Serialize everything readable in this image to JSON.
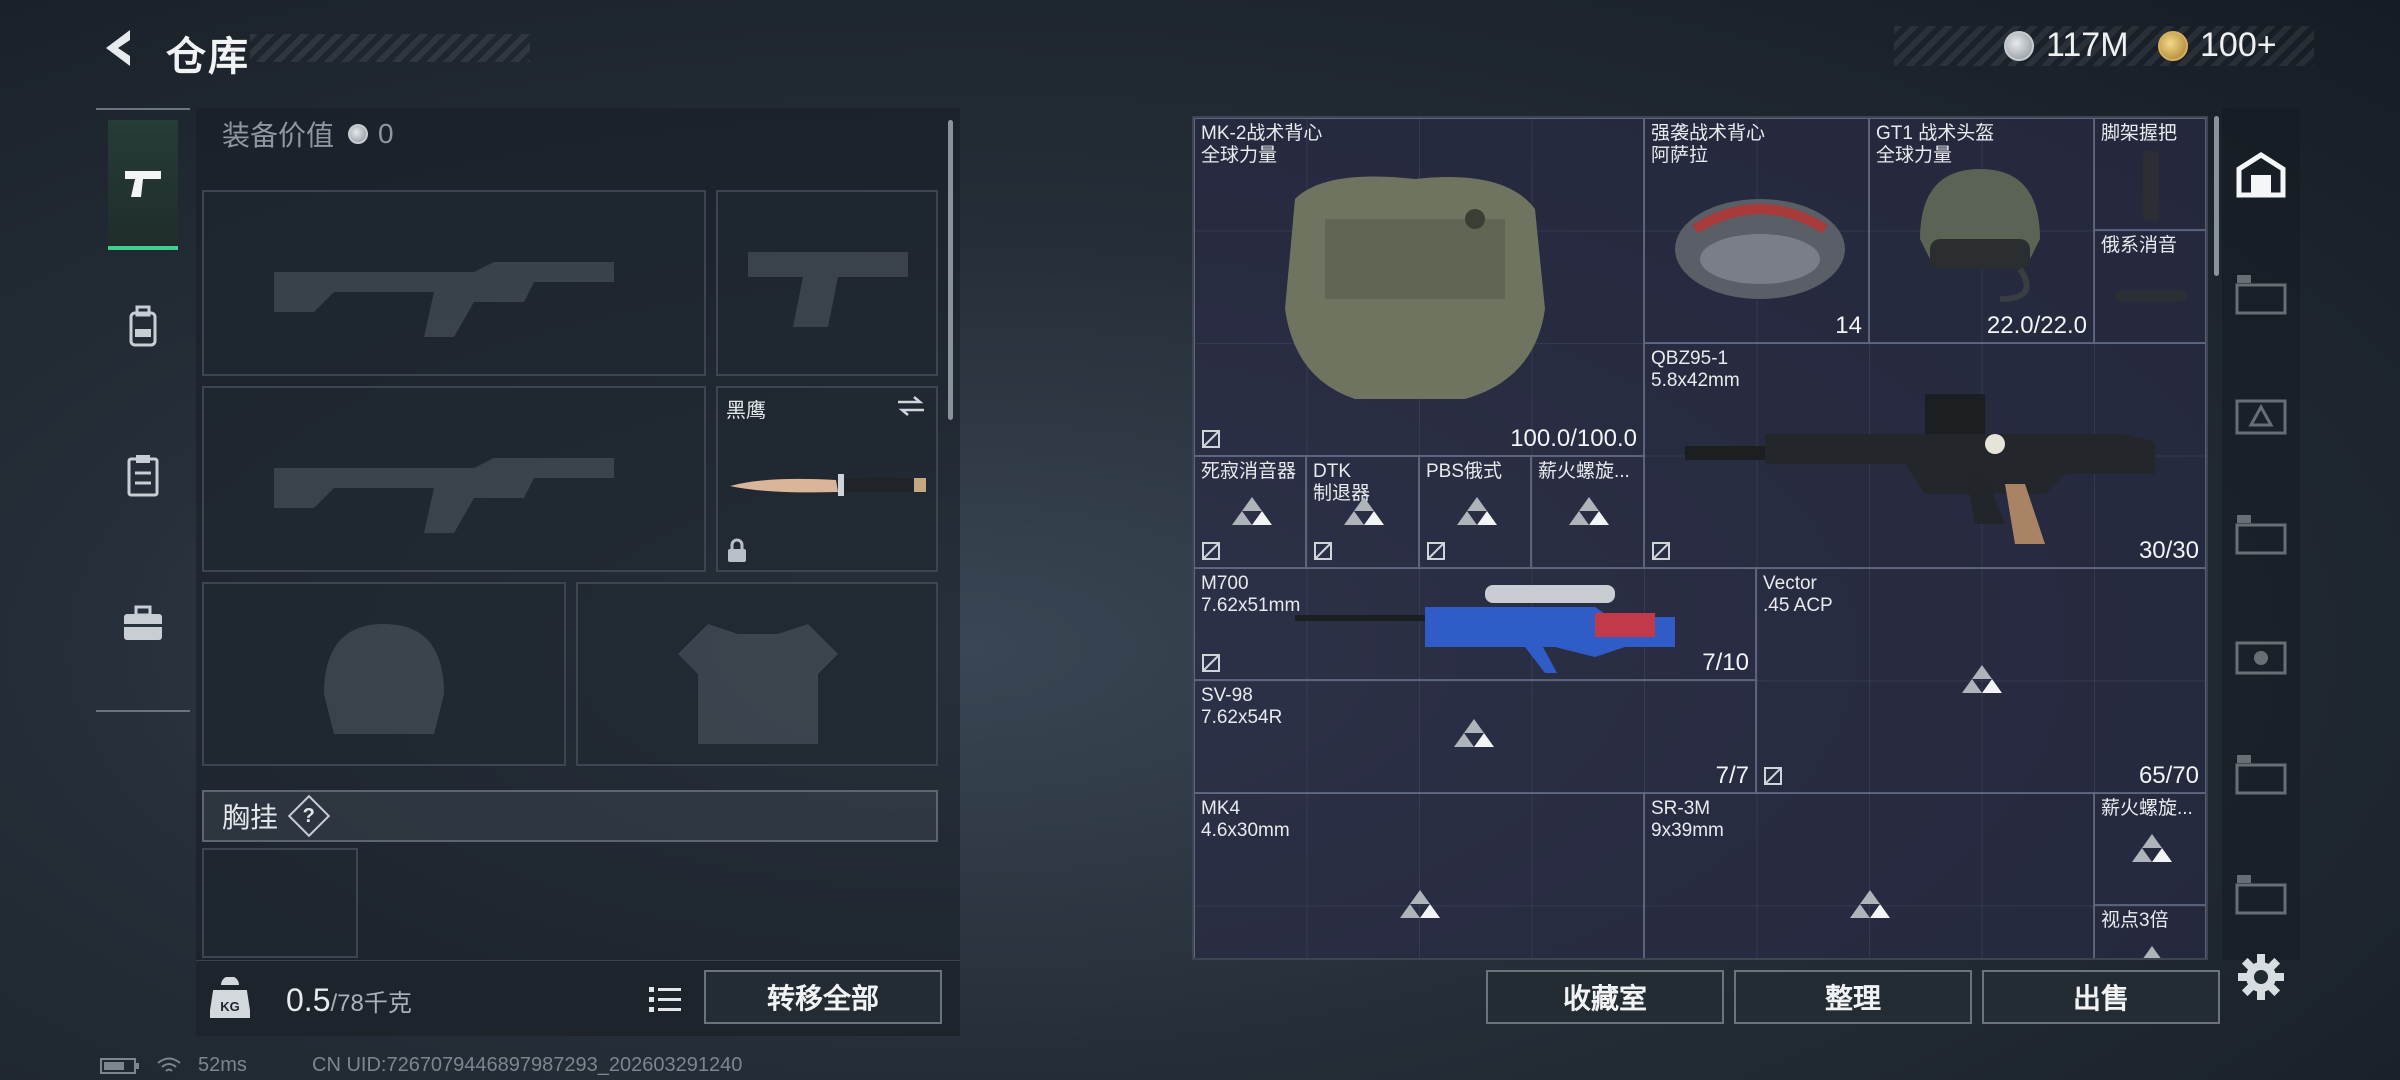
{
  "header": {
    "title": "仓库",
    "currencies": [
      {
        "icon": "silver-coin-icon",
        "value": "117M"
      },
      {
        "icon": "gold-coin-icon",
        "value": "100+"
      }
    ]
  },
  "left_rail": {
    "tabs": [
      {
        "icon": "pistol-icon",
        "active": true
      },
      {
        "icon": "backpack-icon",
        "active": false
      },
      {
        "icon": "clipboard-icon",
        "active": false
      },
      {
        "icon": "briefcase-icon",
        "active": false
      }
    ]
  },
  "equipment": {
    "value_label": "装备价值",
    "value": "0",
    "knife_label": "黑鹰",
    "chest_label": "胸挂",
    "help": "?"
  },
  "bottom_left": {
    "weight_current": "0.5",
    "weight_max": "/78千克",
    "kg_badge": "KG",
    "transfer_all": "转移全部"
  },
  "storage_items": [
    {
      "name": "MK-2战术背心\n全球力量",
      "qty": "100.0/100.0"
    },
    {
      "name": "强袭战术背心\n阿萨拉",
      "qty": "14"
    },
    {
      "name": "GT1 战术头盔\n全球力量",
      "qty": "22.0/22.0"
    },
    {
      "name": "脚架握把",
      "qty": ""
    },
    {
      "name": "俄系消音",
      "qty": ""
    },
    {
      "name": "QBZ95-1\n5.8x42mm",
      "qty": "30/30"
    },
    {
      "name": "死寂消音器",
      "qty": ""
    },
    {
      "name": "DTK\n制退器",
      "qty": ""
    },
    {
      "name": "PBS俄式",
      "qty": ""
    },
    {
      "name": "薪火螺旋...",
      "qty": ""
    },
    {
      "name": "M700\n7.62x51mm",
      "qty": "7/10"
    },
    {
      "name": "Vector\n.45 ACP",
      "qty": "65/70"
    },
    {
      "name": "SV-98\n7.62x54R",
      "qty": "7/7"
    },
    {
      "name": "MK4\n4.6x30mm",
      "qty": ""
    },
    {
      "name": "SR-3M\n9x39mm",
      "qty": ""
    },
    {
      "name": "薪火螺旋...",
      "qty": ""
    },
    {
      "name": "视点3倍",
      "qty": ""
    }
  ],
  "right_rail": {
    "tabs": [
      "helmet-tab-icon",
      "III-case-icon",
      "II-case-icon",
      "IV-case-icon",
      "V-case-icon",
      "III-case-icon-2",
      "III-case-icon-3"
    ]
  },
  "bottom_right": {
    "collection": "收藏室",
    "sort": "整理",
    "sell": "出售"
  },
  "status": {
    "ping": "52ms",
    "uid": "CN UID:7267079446897987293_202603291240"
  }
}
